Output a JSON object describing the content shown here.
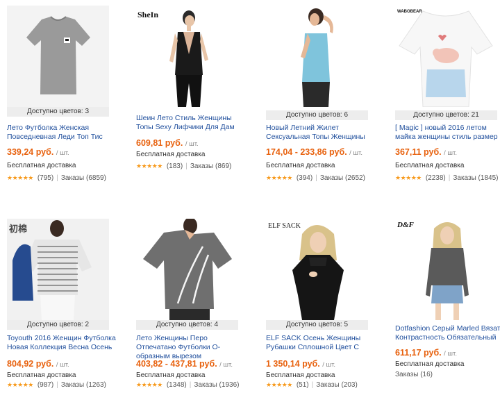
{
  "products": [
    {
      "colors": "Доступно цветов: 3",
      "title": "Лето Футболка Женская Повседневная Леди Топ Тис",
      "price": "339,24 руб.",
      "unit": "/ шт.",
      "shipping": "Бесплатная доставка",
      "stars": "★★★★★",
      "reviews": "(795)",
      "orders": "Заказы (6859)"
    },
    {
      "title": "Шеин Лето Стиль Женщины Топы Sexy Лифчики Для Дам",
      "price": "609,81 руб.",
      "unit": "/ шт.",
      "shipping": "Бесплатная доставка",
      "stars": "★★★★★",
      "reviews": "(183)",
      "orders": "Заказы (869)",
      "brand": "SheIn"
    },
    {
      "colors": "Доступно цветов: 6",
      "title": "Новый Летний Жилет Сексуальная Топы Женщины",
      "price": "174,04 - 233,86 руб.",
      "unit": "/ шт.",
      "shipping": "Бесплатная доставка",
      "stars": "★★★★★",
      "reviews": "(394)",
      "orders": "Заказы (2652)"
    },
    {
      "colors": "Доступно цветов: 21",
      "title": "[ Magic ] новый 2016 летом майка женщины стиль размер",
      "price": "367,11 руб.",
      "unit": "/ шт.",
      "shipping": "Бесплатная доставка",
      "stars": "★★★★★",
      "reviews": "(2238)",
      "orders": "Заказы (1845)",
      "brand": "WABOBEAR"
    },
    {
      "colors": "Доступно цветов: 2",
      "title": "Toyouth 2016 Женщин Футболка Новая Коллекция Весна Осень",
      "price": "804,92 руб.",
      "unit": "/ шт.",
      "shipping": "Бесплатная доставка",
      "stars": "★★★★★",
      "reviews": "(987)",
      "orders": "Заказы (1263)",
      "brand": "初棉"
    },
    {
      "colors": "Доступно цветов: 4",
      "title": "Лето Женщины Перо Отпечатано Футболки О-образным вырезом",
      "price": "403,82 - 437,81 руб.",
      "unit": "/ шт.",
      "shipping": "Бесплатная доставка",
      "stars": "★★★★★",
      "reviews": "(1348)",
      "orders": "Заказы (1936)"
    },
    {
      "colors": "Доступно цветов: 5",
      "title": "ELF SACK Осень Женщины Рубашки Сплошной Цвет С",
      "price": "1 350,14 руб.",
      "unit": "/ шт.",
      "shipping": "Бесплатная доставка",
      "stars": "★★★★★",
      "reviews": "(51)",
      "orders": "Заказы (203)",
      "brand": "ELF SACK"
    },
    {
      "title": "Dotfashion Серый Marled Вязать Контрастность Обязательный",
      "price": "611,17 руб.",
      "unit": "/ шт.",
      "shipping": "Бесплатная доставка",
      "orders": "Заказы (16)",
      "brand": "D&F"
    }
  ],
  "colors": {
    "price": "#e8620f",
    "link": "#1f4e9c",
    "star": "#f79a1d"
  }
}
